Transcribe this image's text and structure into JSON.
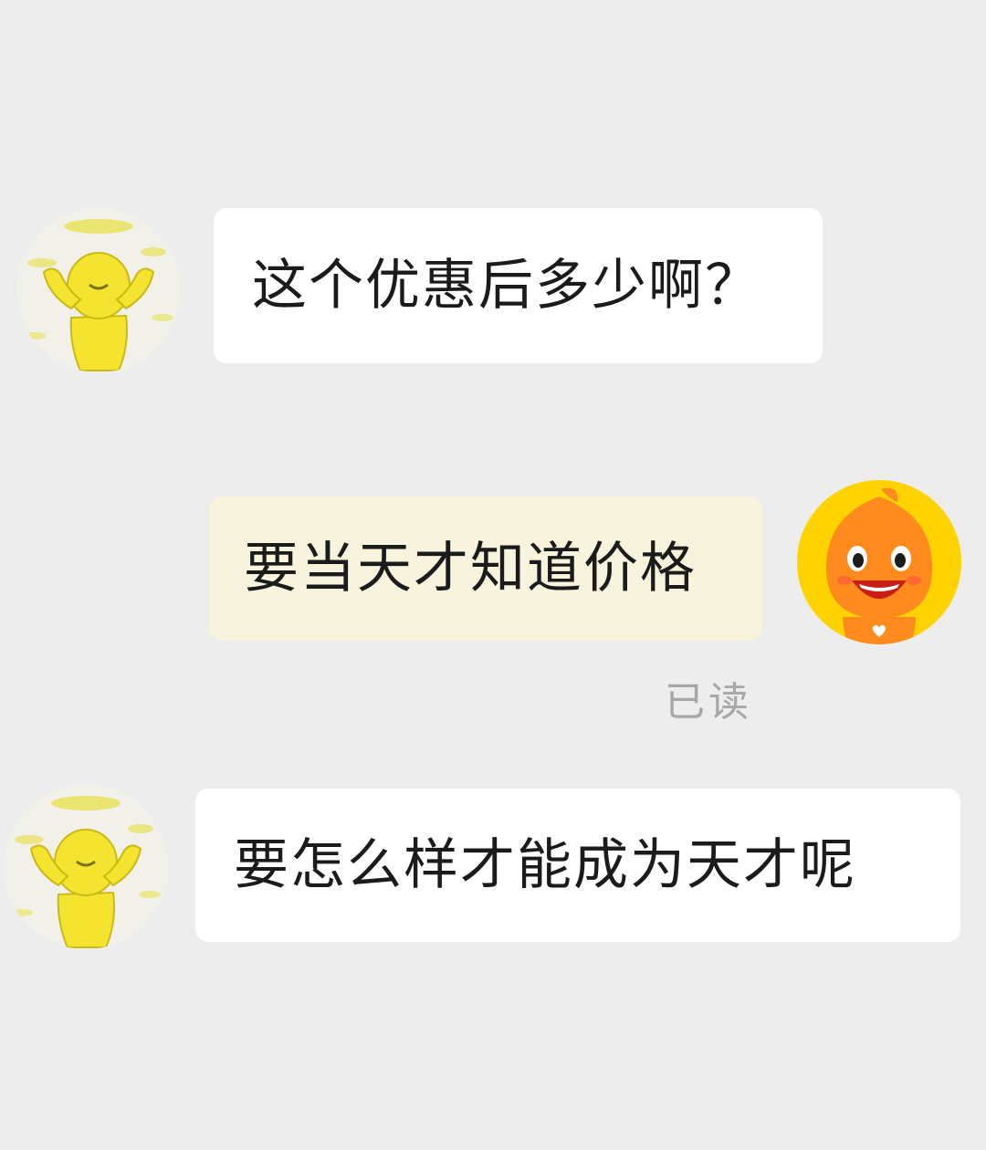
{
  "conversation": {
    "messages": [
      {
        "sender": "contact",
        "text": "这个优惠后多少啊？",
        "avatar_icon": "yellow-dancing-character-icon"
      },
      {
        "sender": "self",
        "text": "要当天才知道价格",
        "avatar_icon": "orange-mascot-icon",
        "status": "已读"
      },
      {
        "sender": "contact",
        "text": "要怎么样才能成为天才呢",
        "avatar_icon": "yellow-dancing-character-icon"
      }
    ]
  },
  "colors": {
    "background": "#ededed",
    "incoming_bubble": "#ffffff",
    "outgoing_bubble": "#f7f3dc",
    "read_status_text": "#a7a7a7"
  }
}
